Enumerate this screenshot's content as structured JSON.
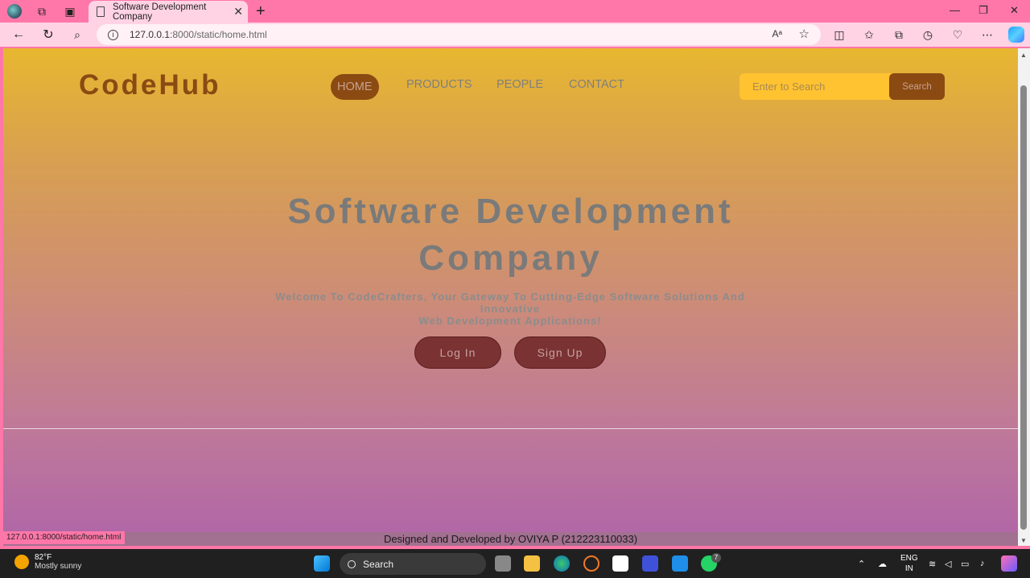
{
  "browser": {
    "tab_title": "Software Development Company",
    "tab_close": "✕",
    "new_tab": "+",
    "url_host": "127.0.0.1",
    "url_path": ":8000/static/home.html",
    "read_aloud": "Aᵃ",
    "window_controls": [
      "—",
      "❐",
      "✕"
    ]
  },
  "site": {
    "logo": "CodeHub",
    "nav": [
      "HOME",
      "PRODUCTS",
      "PEOPLE",
      "CONTACT"
    ],
    "search_placeholder": "Enter to Search",
    "search_button": "Search"
  },
  "hero": {
    "title_line1": "Software Development",
    "title_line2": "Company",
    "subtitle_line1": "Welcome To CodeCrafters, Your Gateway To Cutting-Edge Software Solutions And Innovative",
    "subtitle_line2": "Web Development Applications!",
    "login": "Log In",
    "signup": "Sign Up"
  },
  "footer": {
    "text": "Designed and Developed by OVIYA P (212223110033)"
  },
  "status_url": "127.0.0.1:8000/static/home.html",
  "taskbar": {
    "temp": "82°F",
    "weather": "Mostly sunny",
    "search": "Search",
    "lang1": "ENG",
    "lang2": "IN",
    "whatsapp_badge": "7"
  },
  "colors": {
    "nav_active": "#8a4a12",
    "search_box": "#ffc230",
    "button": "#7a3232",
    "accent_pink": "#ff77a8"
  }
}
